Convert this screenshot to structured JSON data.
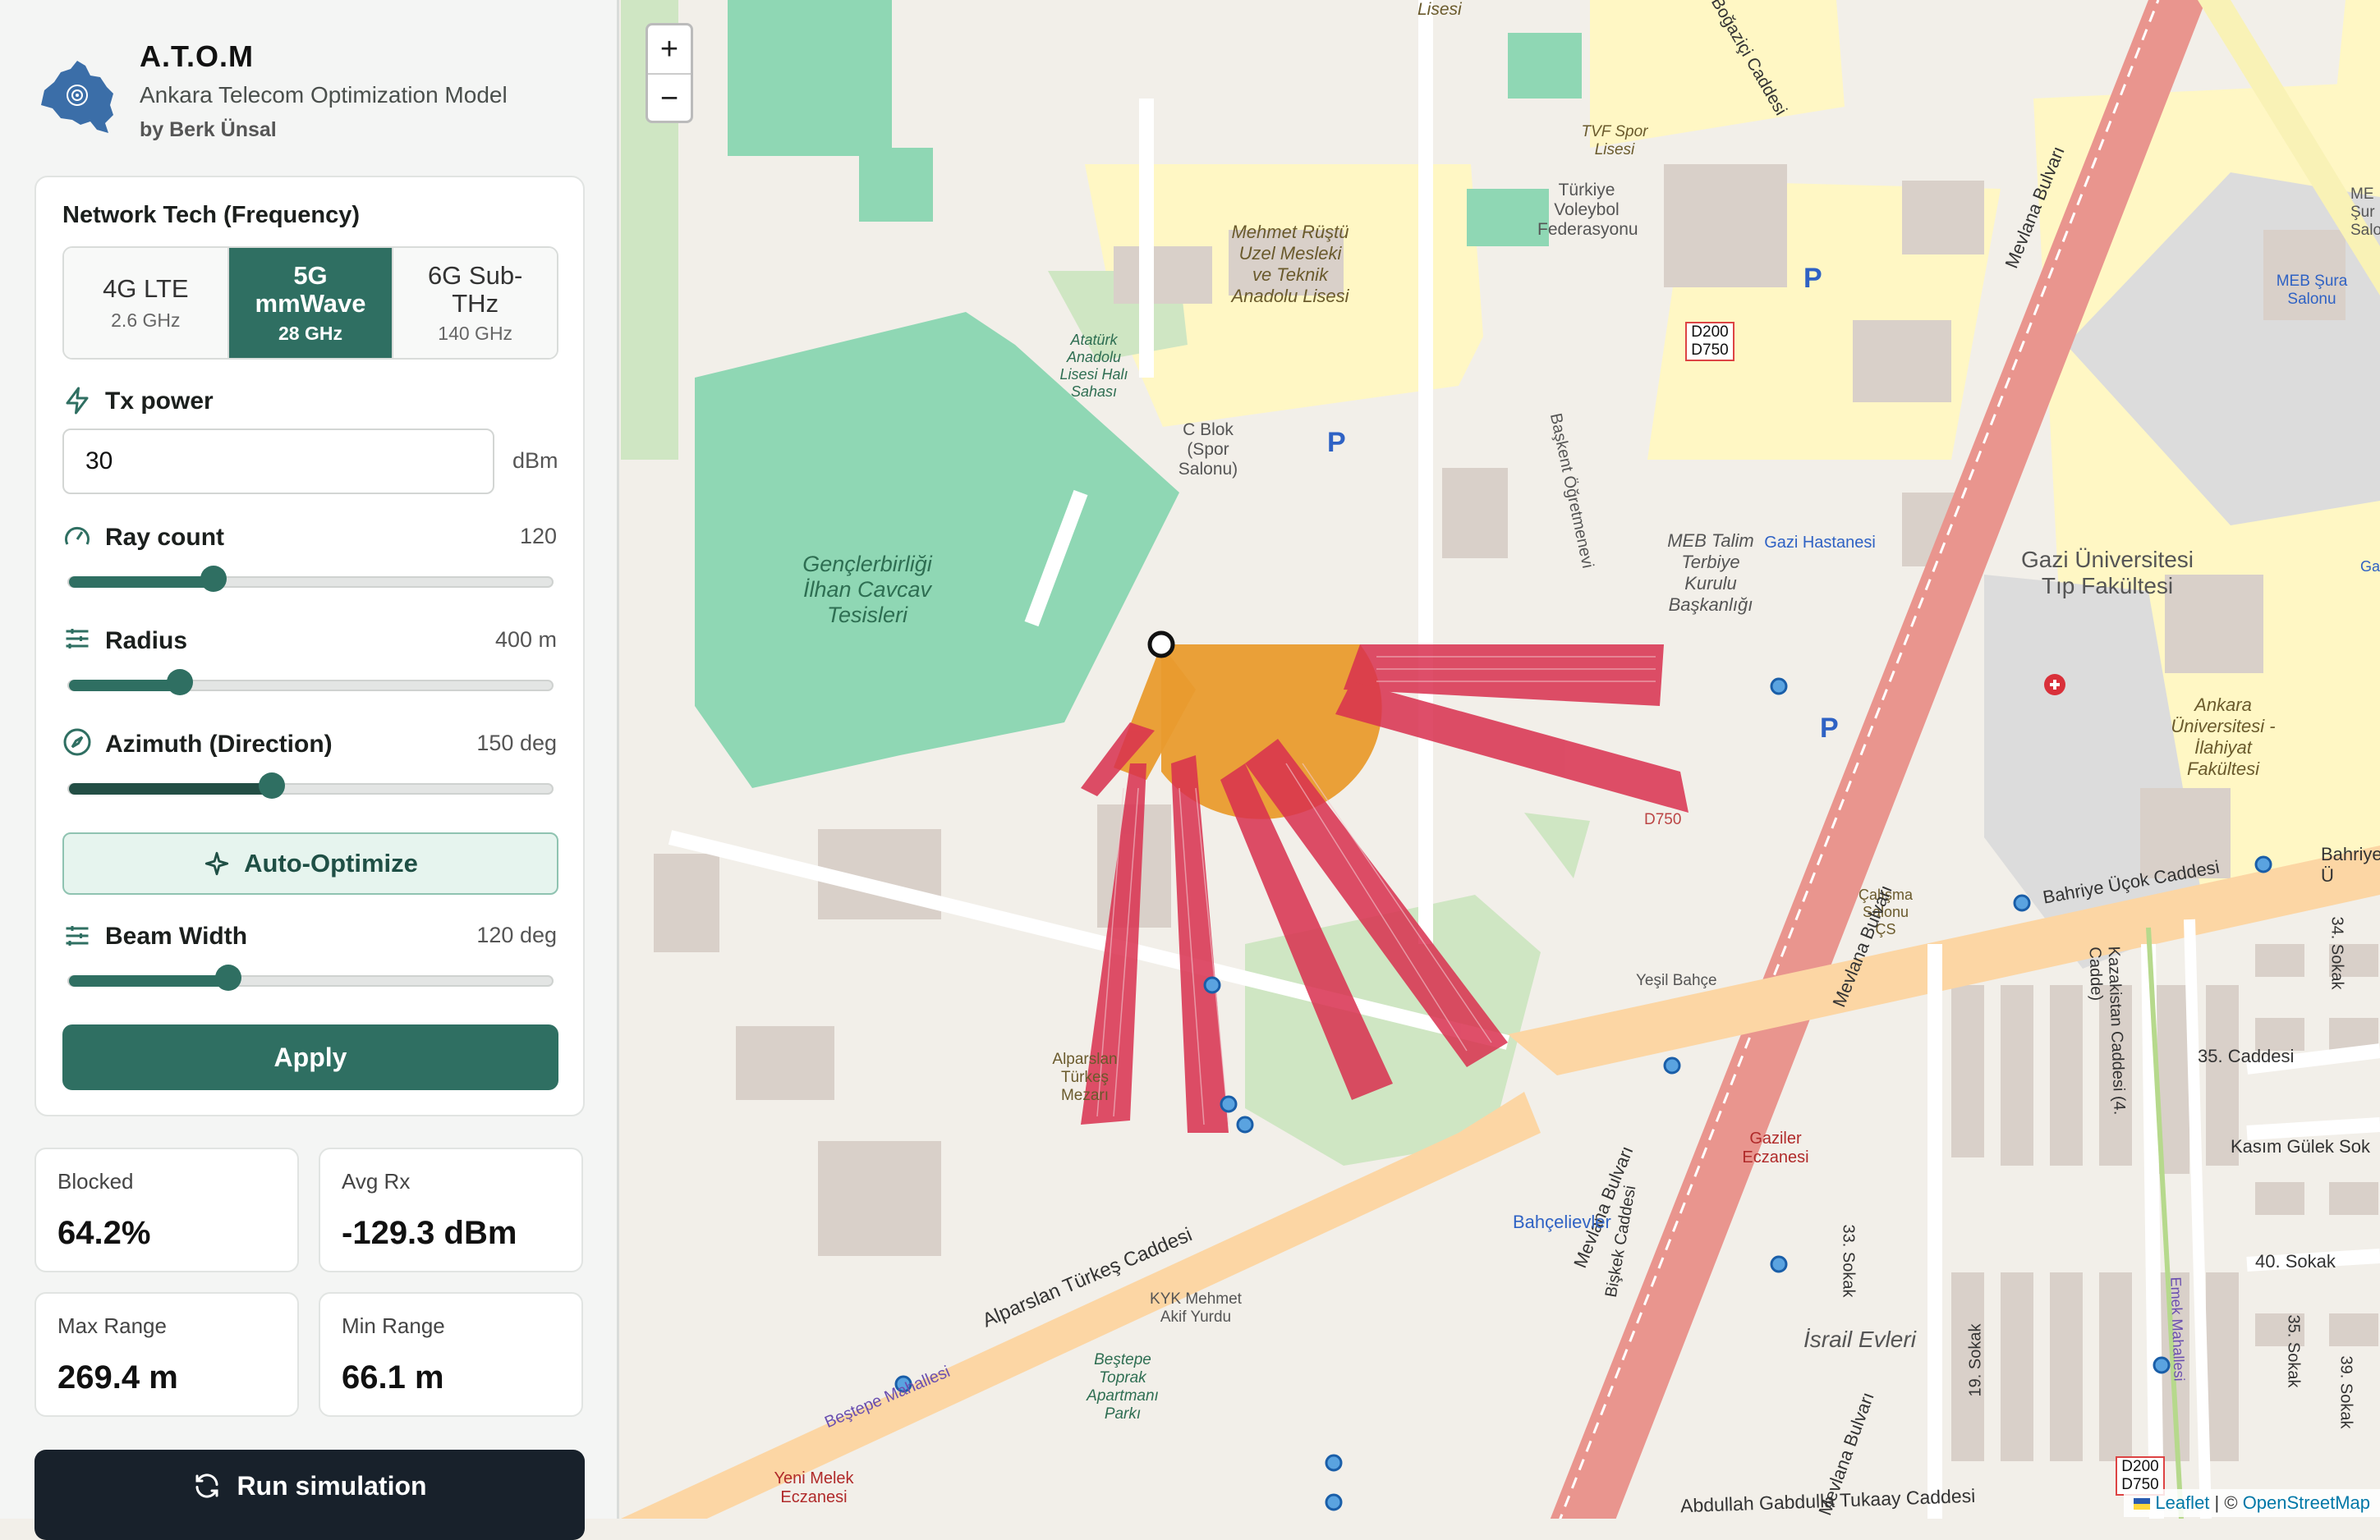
{
  "brand": {
    "title": "A.T.O.M",
    "subtitle": "Ankara Telecom Optimization Model",
    "author": "by Berk Ünsal"
  },
  "network": {
    "label": "Network Tech (Frequency)",
    "options": [
      {
        "name": "4G LTE",
        "freq": "2.6 GHz",
        "active": false
      },
      {
        "name": "5G mmWave",
        "freq": "28 GHz",
        "active": true
      },
      {
        "name": "6G Sub-THz",
        "freq": "140 GHz",
        "active": false
      }
    ]
  },
  "tx_power": {
    "label": "Tx power",
    "value": "30",
    "unit": "dBm"
  },
  "ray_count": {
    "label": "Ray count",
    "value": "120",
    "fraction": 0.3
  },
  "radius": {
    "label": "Radius",
    "value": "400 m",
    "fraction": 0.23
  },
  "azimuth": {
    "label": "Azimuth (Direction)",
    "value": "150 deg",
    "fraction": 0.42
  },
  "auto_optimize": {
    "label": "Auto-Optimize"
  },
  "beam_width": {
    "label": "Beam Width",
    "value": "120 deg",
    "fraction": 0.33
  },
  "apply": {
    "label": "Apply"
  },
  "stats": [
    {
      "label": "Blocked",
      "value": "64.2%"
    },
    {
      "label": "Avg Rx",
      "value": "-129.3 dBm"
    },
    {
      "label": "Max Range",
      "value": "269.4 m"
    },
    {
      "label": "Min Range",
      "value": "66.1 m"
    }
  ],
  "run": {
    "label": "Run simulation"
  },
  "map": {
    "zoom_in": "+",
    "zoom_out": "−",
    "attribution_leaflet": "Leaflet",
    "attribution_sep": " | © ",
    "attribution_osm": "OpenStreetMap",
    "labels": {
      "park": "Gençlerbirliği İlhan Cavcav Tesisleri",
      "school": "Mehmet Rüştü Uzel Mesleki ve Teknik Anadolu Lisesi",
      "ataturk": "Atatürk Anadolu Lisesi Halı Sahası",
      "cblok": "C Blok (Spor Salonu)",
      "tvf": "TVF Spor Lisesi",
      "voleybol": "Türkiye Voleybol Federasyonu",
      "gazi_hast": "Gazi Hastanesi",
      "gazi_tip": "Gazi Üniversitesi Tıp Fakültesi",
      "meb_talim": "MEB Talim Terbiye Kurulu Başkanlığı",
      "meb_sura": "MEB Şura Salonu",
      "ilahiyat": "Ankara Üniversitesi - İlahiyat Fakültesi",
      "calisma": "Çalışma Salonu ÇS",
      "bahriye": "Bahriye Üçok Caddesi",
      "bahriye_r": "Bahriye Ü",
      "kazakistan": "Kazakistan Caddesi (4. Cadde)",
      "mevlana": "Mevlana Bulvarı",
      "alparslan": "Alparslan Türkeş Caddesi",
      "alparslan_mezar": "Alparslan Türkeş Mezarı",
      "bahcelievler": "Bahçelievler",
      "gaziler": "Gaziler Eczanesi",
      "israil": "İsrail Evleri",
      "kyk": "KYK Mehmet Akif Yurdu",
      "bestepe_park": "Beştepe Toprak Apartmanı Parkı",
      "bestepe": "Beştepe Mahallesi",
      "yeni_melek": "Yeni Melek Eczanesi",
      "abdullah": "Abdullah Gabdulla Tukaay Caddesi",
      "sokak33": "33. Sokak",
      "sokak19": "19. Sokak",
      "sokak34": "34. Sokak",
      "sokak35": "35. Caddesi",
      "sokak40": "40. Sokak",
      "kasim": "Kasım Gülek Sok",
      "yesil": "Yeşil Bahçe",
      "bogazici": "Boğaziçi Caddesi",
      "d200": "D200 D750",
      "d750": "D750",
      "emek": "Emek Mahallesi",
      "baskent": "Başkent Öğretmenevi",
      "bisikek": "Bişkek Caddesi",
      "lisesi": "Lisesi",
      "sokak35b": "35. Sokak",
      "sokak39": "39. Sokak",
      "gaz": "Gaz",
      "me": "ME Şur Salo"
    }
  }
}
